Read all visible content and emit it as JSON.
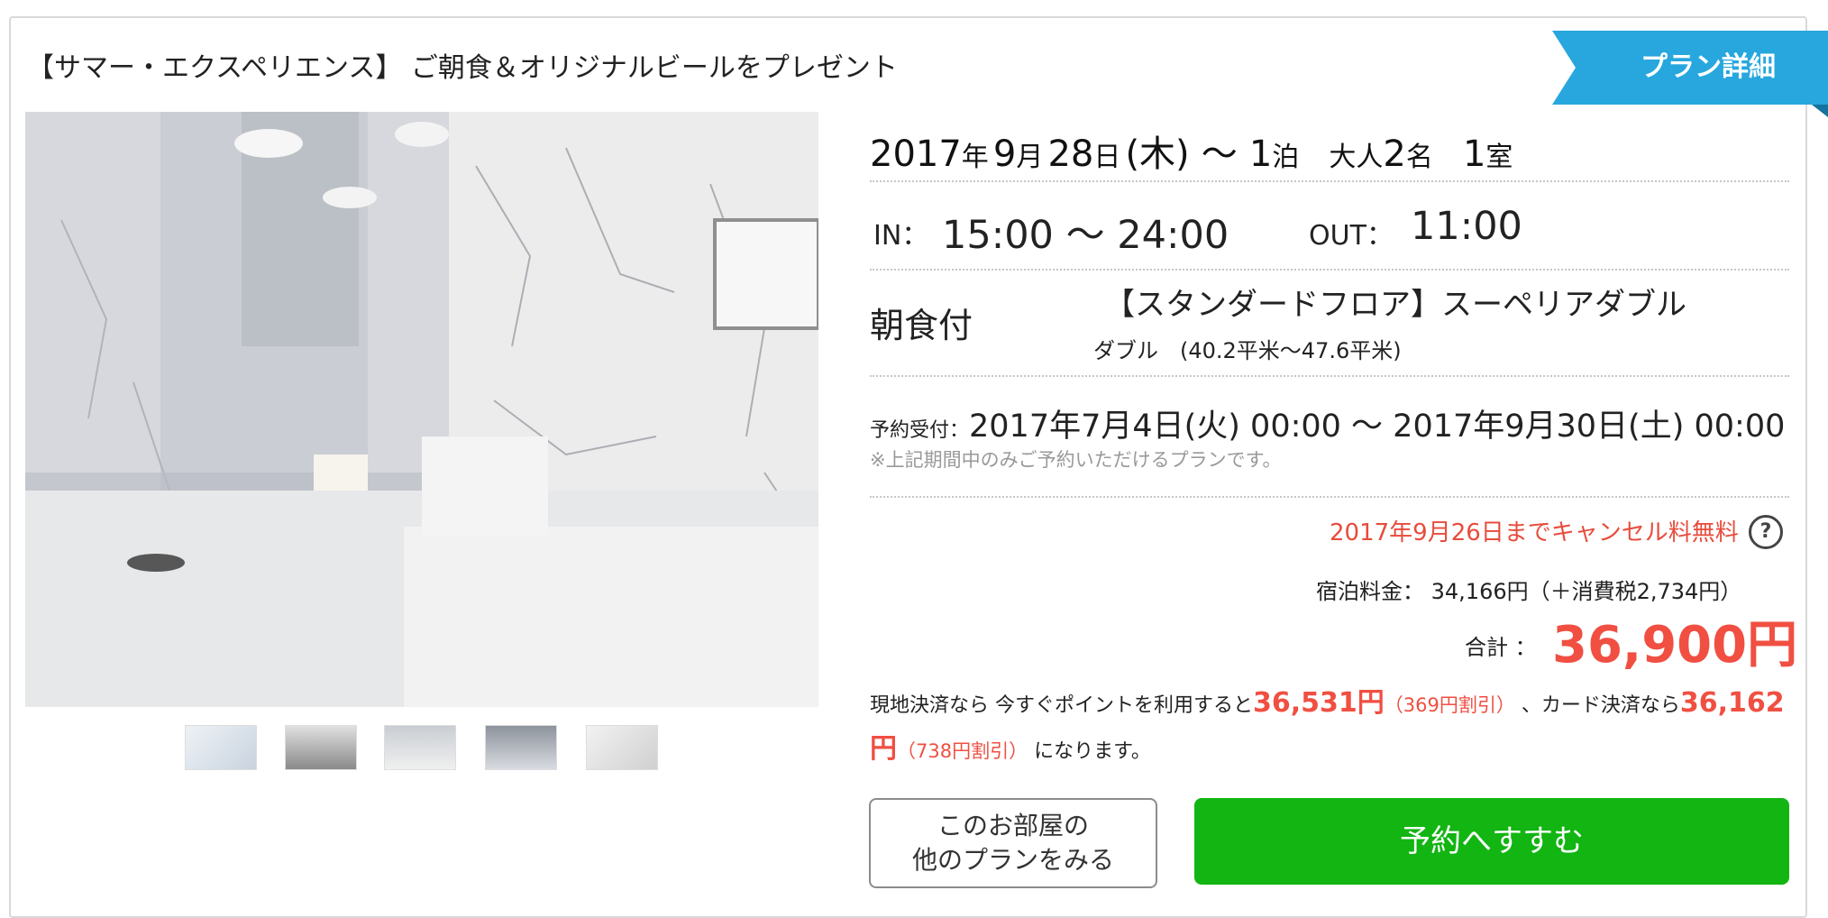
{
  "plan": {
    "title": "【サマー・エクスペリエンス】 ご朝食＆オリジナルビールをプレゼント",
    "detail_button": "プラン詳細"
  },
  "stay": {
    "year": "2017",
    "year_unit": "年",
    "month": "9",
    "month_unit": "月",
    "day": "28",
    "day_unit": "日",
    "weekday": "(木)",
    "tilde": "〜",
    "nights": "1",
    "nights_unit": "泊",
    "adults_label": "大人",
    "adults": "2",
    "adults_unit": "名",
    "rooms": "1",
    "rooms_unit": "室"
  },
  "times": {
    "in_label": "IN：",
    "in_value": "15:00 〜 24:00",
    "out_label": "OUT：",
    "out_value": "11:00"
  },
  "meal": "朝食付",
  "room": {
    "name": "【スタンダードフロア】スーペリアダブル",
    "sub": "ダブル　(40.2平米〜47.6平米)"
  },
  "reservation": {
    "label": "予約受付：",
    "period": "2017年7月4日(火) 00:00 〜 2017年9月30日(土) 00:00",
    "note": "※上記期間中のみご予約いただけるプランです。"
  },
  "price": {
    "cancel_note": "2017年9月26日までキャンセル料無料",
    "help_icon": "?",
    "room_charge": "宿泊料金：  34,166円（＋消費税2,734円）",
    "total_label": "合計 ：",
    "total_value": "36,900円"
  },
  "points": {
    "prefix": "現地決済なら 今すぐポイントを利用すると",
    "onsite_price": "36,531円",
    "onsite_discount": "（369円割引）",
    "middle": "、カード決済なら",
    "card_price": "36,162円",
    "card_discount": "（738円割引）",
    "suffix": "になります。"
  },
  "buttons": {
    "other_plans_line1": "このお部屋の",
    "other_plans_line2": "他のプランをみる",
    "reserve": "予約へすすむ"
  },
  "colors": {
    "ribbon": "#27a7dd",
    "accent_red": "#f04f42",
    "reserve_green": "#12b512"
  }
}
